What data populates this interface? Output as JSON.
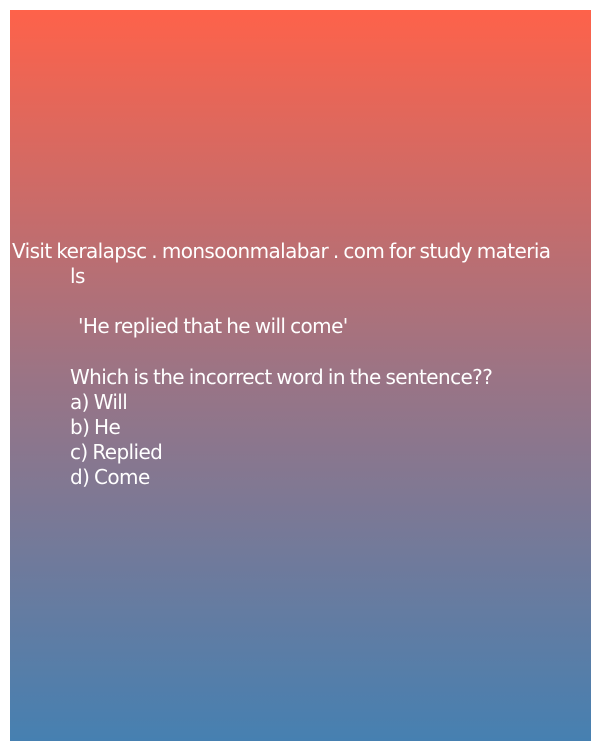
{
  "post": {
    "header_line1": "Visit keralapsc . monsoonmalabar . com for study materia",
    "header_line2": "ls",
    "quote": "'He replied that he will come'",
    "question": "Which is the incorrect word in the sentence??",
    "options": [
      "a) Will",
      "b) He",
      "c) Replied",
      "d) Come"
    ]
  },
  "colors": {
    "gradient_top": "#fe624a",
    "gradient_mid": "#9b7485",
    "gradient_bottom": "#4680b1",
    "text": "#ffffff"
  }
}
